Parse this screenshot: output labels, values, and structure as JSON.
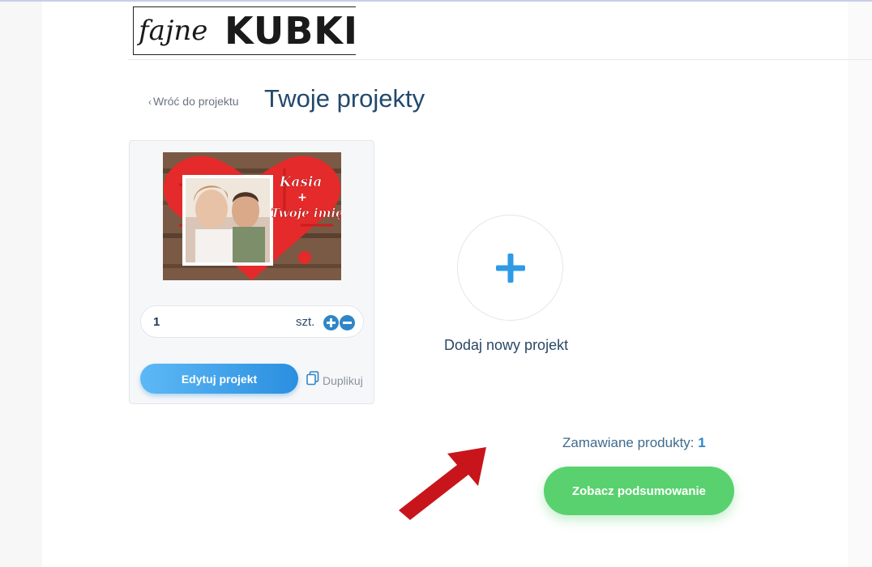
{
  "logo": {
    "script_text": "fajne",
    "block_text": "KUBKI"
  },
  "nav": {
    "back_label": "Wróć do projektu",
    "back_chevron": "‹"
  },
  "page": {
    "title": "Twoje projekty"
  },
  "project_card": {
    "thumbnail": {
      "name_top": "Kasia",
      "name_plus": "+",
      "name_bottom": "Twoje imię"
    },
    "quantity": {
      "value": "1",
      "unit": "szt."
    },
    "edit_label": "Edytuj projekt",
    "duplicate_label": "Duplikuj"
  },
  "add_project": {
    "label": "Dodaj nowy projekt"
  },
  "summary": {
    "products_label": "Zamawiane produkty:",
    "products_count": "1",
    "button_label": "Zobacz podsumowanie"
  },
  "colors": {
    "title": "#23496c",
    "accent_blue": "#2e86c9",
    "button_green": "#5ad16f",
    "arrow_red": "#c8151b"
  },
  "icons": [
    "plus-circle-icon",
    "minus-circle-icon",
    "copy-icon",
    "plus-icon",
    "red-arrow-annotation"
  ]
}
